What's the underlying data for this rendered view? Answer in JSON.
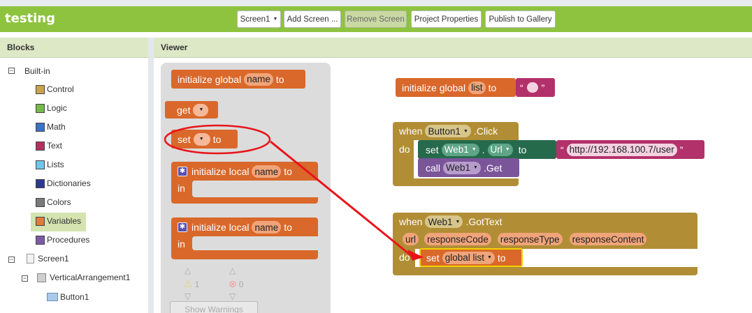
{
  "app": {
    "title": "testing"
  },
  "toolbar": {
    "screen_select": "Screen1",
    "add_screen": "Add Screen ...",
    "remove_screen": "Remove Screen",
    "project_properties": "Project Properties",
    "publish": "Publish to Gallery"
  },
  "blocks_panel": {
    "title": "Blocks",
    "builtin_label": "Built-in",
    "categories": [
      {
        "label": "Control",
        "color": "#c9a44a"
      },
      {
        "label": "Logic",
        "color": "#76b947"
      },
      {
        "label": "Math",
        "color": "#3a72c4"
      },
      {
        "label": "Text",
        "color": "#b5305f"
      },
      {
        "label": "Lists",
        "color": "#6cc7e8"
      },
      {
        "label": "Dictionaries",
        "color": "#2b3a8f"
      },
      {
        "label": "Colors",
        "color": "#7a7a7a"
      },
      {
        "label": "Variables",
        "color": "#e07a3a"
      },
      {
        "label": "Procedures",
        "color": "#7d5aa6"
      }
    ],
    "screen_label": "Screen1",
    "arrangement_label": "VerticalArrangement1",
    "button_label": "Button1"
  },
  "viewer": {
    "title": "Viewer"
  },
  "flyout": {
    "init_global": {
      "prefix": "initialize global",
      "name": "name",
      "to": "to"
    },
    "get": {
      "label": "get"
    },
    "set": {
      "label": "set",
      "to": "to"
    },
    "init_local_1": {
      "prefix": "initialize local",
      "name": "name",
      "to": "to",
      "in": "in"
    },
    "init_local_2": {
      "prefix": "initialize local",
      "name": "name",
      "to": "to",
      "in": "in"
    },
    "warnings": {
      "warn_count": "1",
      "error_count": "0",
      "show_label": "Show Warnings"
    }
  },
  "workspace": {
    "global_list": {
      "prefix": "initialize global",
      "name": "list",
      "to": "to",
      "open_quote": "“",
      "close_quote": "”"
    },
    "button_click": {
      "when": "when",
      "component": "Button1",
      "event": ".Click",
      "do": "do",
      "set_label": "set",
      "set_component": "Web1",
      "dot": ".",
      "property": "Url",
      "to": "to",
      "url_value": "http://192.168.100.7/user",
      "open_quote": "“",
      "close_quote": "”",
      "call_label": "call",
      "call_component": "Web1",
      "call_method": ".Get"
    },
    "got_text": {
      "when": "when",
      "component": "Web1",
      "event": ".GotText",
      "params": [
        "url",
        "responseCode",
        "responseType",
        "responseContent"
      ],
      "do": "do",
      "set_label": "set",
      "set_var": "global list",
      "to": "to"
    }
  },
  "colors": {
    "topbar": "#8ec33f",
    "variables_block": "#d9682a",
    "event_block": "#b18e35",
    "setter_block": "#266a4c",
    "call_block": "#7b559a",
    "text_block": "#b3316a",
    "annotation": "#e8141a"
  }
}
